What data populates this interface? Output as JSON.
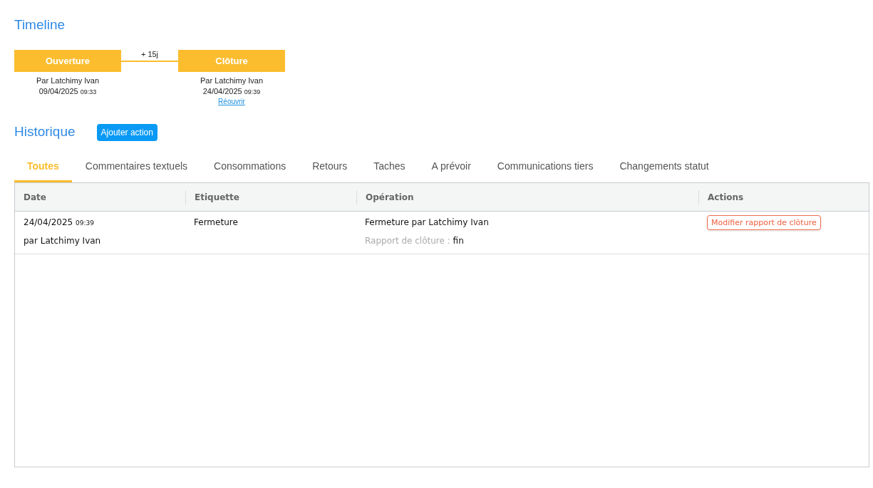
{
  "timeline": {
    "title": "Timeline",
    "steps": [
      {
        "label": "Ouverture",
        "by": "Par Latchimy Ivan",
        "date": "09/04/2025",
        "time": "09:33"
      },
      {
        "label": "Clôture",
        "by": "Par Latchimy Ivan",
        "date": "24/04/2025",
        "time": "09:39",
        "link": "Réouvrir"
      }
    ],
    "gaps": [
      "+ 15j"
    ]
  },
  "history": {
    "title": "Historique",
    "add_button": "Ajouter action",
    "tabs": [
      {
        "label": "Toutes",
        "selected": true
      },
      {
        "label": "Commentaires textuels",
        "selected": false
      },
      {
        "label": "Consommations",
        "selected": false
      },
      {
        "label": "Retours",
        "selected": false
      },
      {
        "label": "Taches",
        "selected": false
      },
      {
        "label": "A prévoir",
        "selected": false
      },
      {
        "label": "Communications tiers",
        "selected": false
      },
      {
        "label": "Changements statut",
        "selected": false
      }
    ],
    "table": {
      "columns": [
        "Date",
        "Etiquette",
        "Opération",
        "Actions"
      ],
      "rows": [
        {
          "date": "24/04/2025",
          "time": "09:39",
          "author": "par Latchimy Ivan",
          "label": "Fermeture",
          "operation": "Fermeture par Latchimy Ivan",
          "detail_label": "Rapport de clôture :",
          "detail_value": "fin",
          "action": "Modifier rapport de clôture"
        }
      ]
    }
  }
}
